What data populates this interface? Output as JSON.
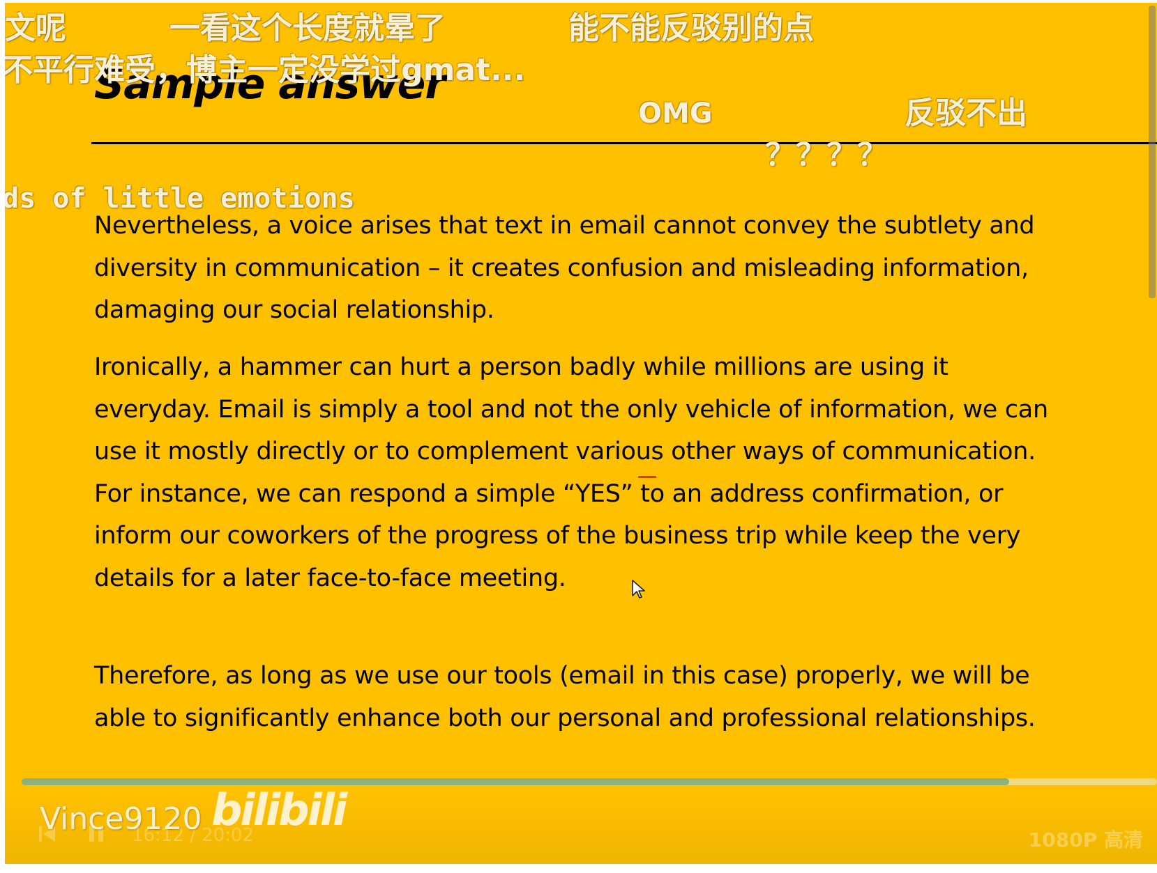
{
  "slide": {
    "title": "Sample answer",
    "paragraphs": [
      "Nevertheless, a voice arises that text in email cannot convey the subtlety and diversity in communication – it creates confusion and misleading information, damaging our social relationship.",
      "Ironically, a hammer can hurt a person badly while millions are using it everyday. Email is simply a tool and not the only vehicle of information, we can use it mostly directly or to complement various other ways of communication. For instance, we can respond a simple “YES” to an address confirmation, or inform our coworkers of the progress of the business trip while keep the very details for a later face-to-face meeting.",
      "Therefore, as long as we use our tools (email in this case) properly, we will be able to significantly enhance both our personal and professional relationships."
    ]
  },
  "danmaku": [
    {
      "text": "文呢",
      "mono": false
    },
    {
      "text": "一看这个长度就晕了",
      "mono": false
    },
    {
      "text": "能不能反驳别的点",
      "mono": false
    },
    {
      "text": "不平行难受，博主一定没学过gmat...",
      "mono": false
    },
    {
      "text": "OMG",
      "mono": false
    },
    {
      "text": "反驳不出",
      "mono": false
    },
    {
      "text": "？？？？",
      "mono": false
    },
    {
      "text": "ds of little emotions",
      "mono": true
    }
  ],
  "player": {
    "uploader": "Vince9120",
    "logo": "bilibili",
    "time": "16:12 / 20:02",
    "quality": "1080P 高清",
    "progress_fraction": 0.87,
    "accent_color": "#ffc000",
    "progress_color": "#8db17a"
  },
  "icons": {
    "prev": "skip-back-icon",
    "pause": "pause-icon",
    "cursor": "mouse-pointer-icon"
  }
}
